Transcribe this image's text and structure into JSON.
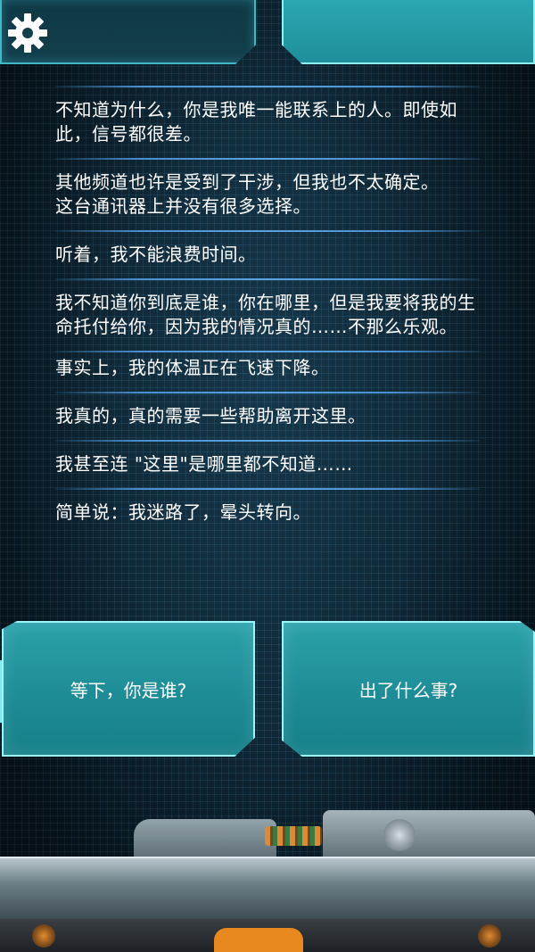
{
  "messages": [
    "不知道为什么，你是我唯一能联系上的人。即使如此，信号都很差。",
    "其他频道也许是受到了干涉，但我也不太确定。\n这台通讯器上并没有很多选择。",
    "听着，我不能浪费时间。",
    "我不知道你到底是谁，你在哪里，但是我要将我的生命托付给你，因为我的情况真的……不那么乐观。",
    "事实上，我的体温正在飞速下降。",
    "我真的，真的需要一些帮助离开这里。",
    "我甚至连 \"这里\"是哪里都不知道……",
    "简单说：我迷路了，晕头转向。"
  ],
  "choices": {
    "left": "等下，你是谁?",
    "right": "出了什么事?"
  },
  "icons": {
    "settings": "gear-icon"
  },
  "colors": {
    "accent": "#3fb7c4",
    "button": "#2ba2ab",
    "divider": "#4a8fd0"
  }
}
